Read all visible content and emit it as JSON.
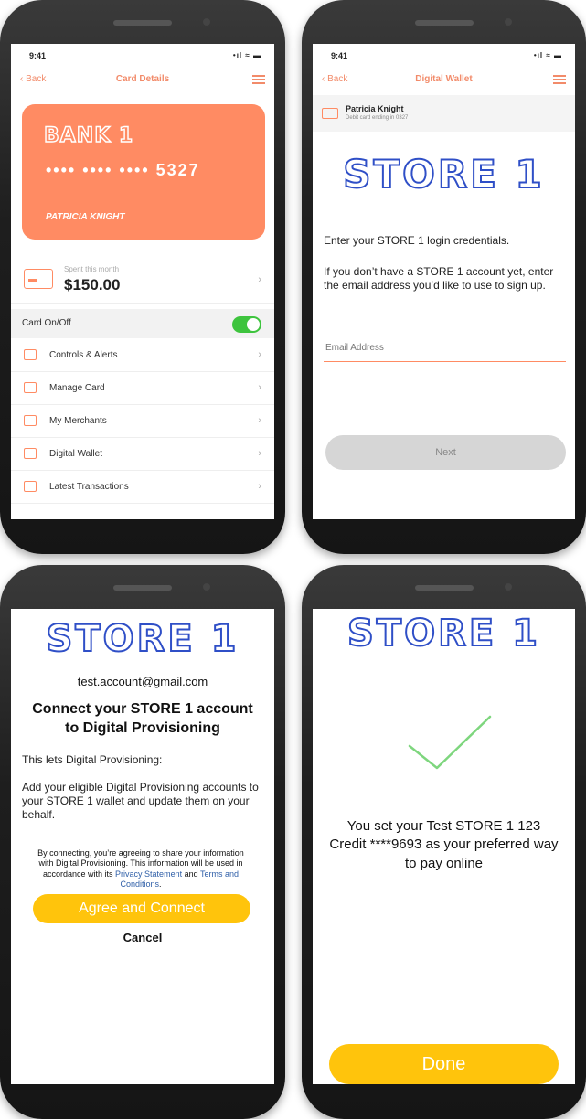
{
  "phone1": {
    "time": "9:41",
    "signal": "•ıl ≈ ▬",
    "back": "Back",
    "title": "Card Details",
    "bank": "BANK 1",
    "card_number": "•••• •••• ••••  5327",
    "holder": "PATRICIA KNIGHT",
    "spent_label": "Spent this month",
    "spent_amount": "$150.00",
    "toggle_label": "Card On/Off",
    "toggle_on": true,
    "menu": [
      {
        "label": "Controls & Alerts",
        "icon": "lock-icon"
      },
      {
        "label": "Manage Card",
        "icon": "card-icon"
      },
      {
        "label": "My Merchants",
        "icon": "cart-icon"
      },
      {
        "label": "Digital Wallet",
        "icon": "wallet-icon"
      },
      {
        "label": "Latest Transactions",
        "icon": "document-icon"
      }
    ]
  },
  "phone2": {
    "time": "9:41",
    "signal": "•ıl ≈ ▬",
    "back": "Back",
    "title": "Digital Wallet",
    "cardholder": "Patricia Knight",
    "card_sub": "Debit card ending in 0327",
    "logo": "STORE 1",
    "p1": "Enter your STORE 1 login credentials.",
    "p2": "If you don’t have a STORE 1 account yet, enter the email address you’d like to use to sign up.",
    "email_placeholder": "Email Address",
    "next": "Next"
  },
  "phone3": {
    "logo": "STORE 1",
    "email": "test.account@gmail.com",
    "heading": "Connect your STORE 1 account to Digital Provisioning",
    "lets": "This lets Digital Provisioning:",
    "body": "Add your eligible Digital Provisioning accounts to your STORE 1 wallet and update them on your behalf.",
    "legal_1": "By connecting, you’re agreeing to share your information with Digital Provisioning. This information will be used in accordance with its",
    "privacy": "Privacy Statement",
    "and": "and",
    "terms": "Terms and Conditions",
    "period": ".",
    "agree": "Agree and Connect",
    "cancel": "Cancel"
  },
  "phone4": {
    "logo": "STORE 1",
    "message": "You set your Test STORE 1 123 Credit ****9693 as your preferred way to pay online",
    "done": "Done"
  },
  "colors": {
    "accent": "#ff8b63",
    "brand_blue": "#2f4fc7",
    "button_yellow": "#ffc40c",
    "check_green": "#7ed67e",
    "toggle_green": "#3ec43e"
  }
}
